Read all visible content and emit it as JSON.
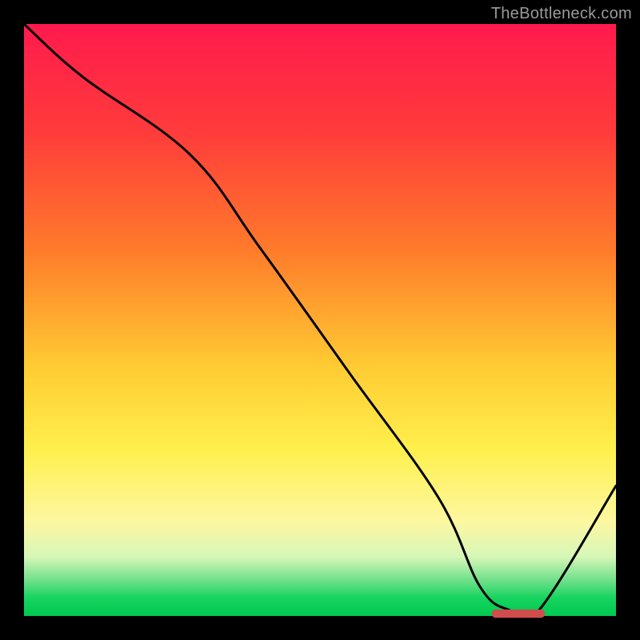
{
  "watermark": "TheBottleneck.com",
  "colors": {
    "curve_stroke": "#000000",
    "marker_fill": "#cf4d4d",
    "gradient_top": "#ff1a4d",
    "gradient_bottom": "#00c94f",
    "background": "#000000"
  },
  "chart_data": {
    "type": "line",
    "title": "",
    "xlabel": "",
    "ylabel": "",
    "xlim": [
      0,
      100
    ],
    "ylim": [
      0,
      100
    ],
    "series": [
      {
        "name": "bottleneck-curve",
        "x": [
          0,
          10,
          28,
          40,
          55,
          70,
          77,
          82,
          87,
          100
        ],
        "values": [
          100,
          91,
          78,
          62,
          41,
          20,
          5,
          1,
          1,
          22
        ]
      }
    ],
    "annotations": [
      {
        "name": "optimal-marker",
        "shape": "pill",
        "x_start": 79,
        "x_end": 88,
        "y": 0.5
      }
    ]
  }
}
